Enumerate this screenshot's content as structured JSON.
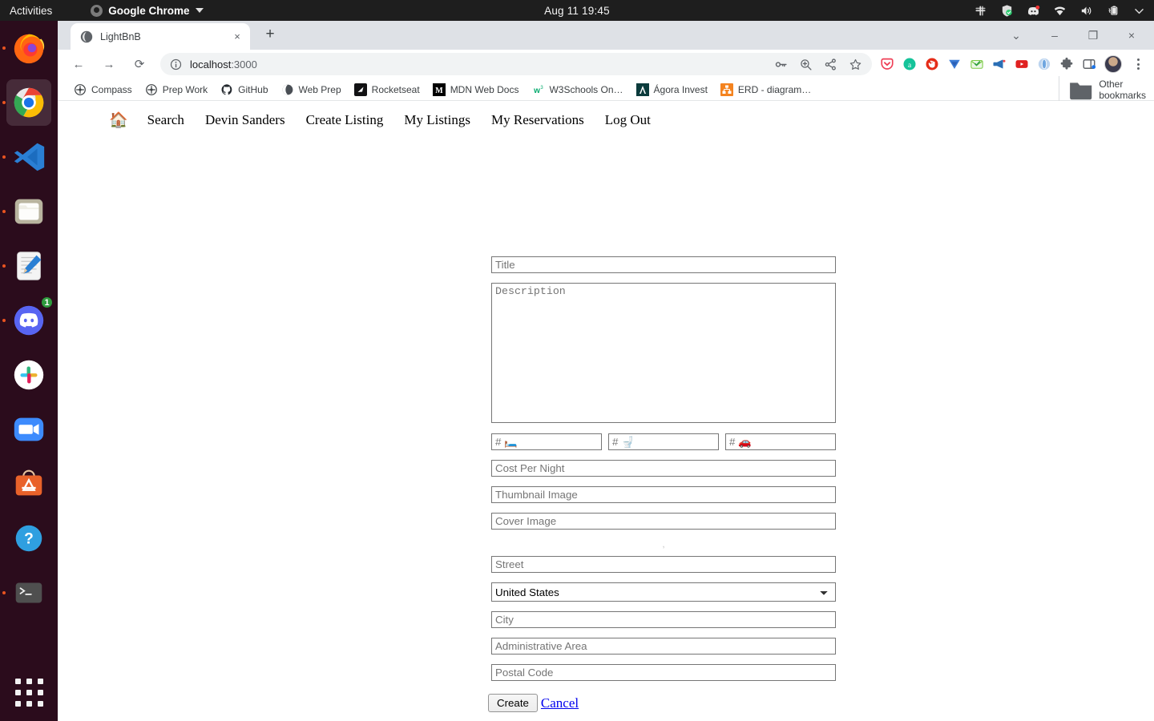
{
  "desktop": {
    "activities": "Activities",
    "app_menu": "Google Chrome",
    "clock": "Aug 11  19:45",
    "tray_icons": [
      "slack-icon",
      "shield-check-icon",
      "discord-icon",
      "wifi-icon",
      "volume-icon",
      "battery-charging-icon",
      "system-menu-caret-icon"
    ],
    "dock": [
      {
        "name": "firefox",
        "label": "Firefox",
        "running": true,
        "badge": ""
      },
      {
        "name": "google-chrome",
        "label": "Google Chrome",
        "running": true,
        "badge": "",
        "active": true
      },
      {
        "name": "visual-studio-code",
        "label": "Visual Studio Code",
        "running": true,
        "badge": ""
      },
      {
        "name": "files",
        "label": "Files",
        "running": true,
        "badge": ""
      },
      {
        "name": "text-editor",
        "label": "Text Editor",
        "running": true,
        "badge": ""
      },
      {
        "name": "discord",
        "label": "Discord",
        "running": true,
        "badge": "1"
      },
      {
        "name": "slack",
        "label": "Slack",
        "running": false,
        "badge": ""
      },
      {
        "name": "zoom",
        "label": "Zoom",
        "running": false,
        "badge": ""
      },
      {
        "name": "ubuntu-software",
        "label": "Ubuntu Software",
        "running": false,
        "badge": ""
      },
      {
        "name": "help",
        "label": "Help",
        "running": false,
        "badge": ""
      },
      {
        "name": "terminal",
        "label": "Terminal",
        "running": true,
        "badge": ""
      }
    ]
  },
  "browser": {
    "tab": {
      "title": "LightBnB",
      "favicon": "globe-icon",
      "close_label": "×"
    },
    "new_tab_label": "+",
    "window_controls": {
      "search_tabs": "⌄",
      "minimize": "–",
      "maximize": "❐",
      "close": "×"
    },
    "nav_buttons": {
      "back": "←",
      "forward": "→",
      "reload": "⟳"
    },
    "omnibox": {
      "url_host": "localhost",
      "url_port": ":3000",
      "site_info_icon": "info-circle-icon",
      "right_icons": [
        "password-key-icon",
        "zoom-in-icon",
        "share-icon",
        "bookmark-star-icon"
      ]
    },
    "extensions": [
      "pocket-icon",
      "grammarly-a-icon",
      "adblock-icon",
      "bluejeans-icon",
      "mailtrack-icon",
      "megaphone-icon",
      "youtube-icon",
      "opera-icon",
      "puzzle-extensions-icon",
      "side-panel-icon"
    ],
    "profile": "avatar",
    "menu": "chrome-menu-icon",
    "bookmarks": [
      {
        "label": "Compass",
        "icon": "compass-icon"
      },
      {
        "label": "Prep Work",
        "icon": "compass-icon"
      },
      {
        "label": "GitHub",
        "icon": "github-icon"
      },
      {
        "label": "Web Prep",
        "icon": "globe-icon"
      },
      {
        "label": "Rocketseat",
        "icon": "rocketseat-icon"
      },
      {
        "label": "MDN Web Docs",
        "icon": "mdn-icon"
      },
      {
        "label": "W3Schools On…",
        "icon": "w3schools-icon"
      },
      {
        "label": "Ágora Invest",
        "icon": "agora-icon"
      },
      {
        "label": "ERD - diagram…",
        "icon": "erd-icon"
      }
    ],
    "other_bookmarks": {
      "label": "Other bookmarks",
      "icon": "folder-icon"
    }
  },
  "page": {
    "nav": {
      "home_icon": "🏠",
      "links": [
        "Search",
        "Devin Sanders",
        "Create Listing",
        "My Listings",
        "My Reservations",
        "Log Out"
      ]
    },
    "form": {
      "title": {
        "placeholder": "Title",
        "value": ""
      },
      "description": {
        "placeholder": "Description",
        "value": ""
      },
      "bedrooms": {
        "placeholder": "# 🛏️",
        "value": ""
      },
      "bathrooms": {
        "placeholder": "# 🚽",
        "value": ""
      },
      "parking": {
        "placeholder": "# 🚗",
        "value": ""
      },
      "cost_per_night": {
        "placeholder": "Cost Per Night",
        "value": ""
      },
      "thumbnail_image": {
        "placeholder": "Thumbnail Image",
        "value": ""
      },
      "cover_image": {
        "placeholder": "Cover Image",
        "value": ""
      },
      "separator_text": ",",
      "street": {
        "placeholder": "Street",
        "value": ""
      },
      "country": {
        "selected": "United States",
        "options": [
          "United States"
        ]
      },
      "city": {
        "placeholder": "City",
        "value": ""
      },
      "administrative_area": {
        "placeholder": "Administrative Area",
        "value": ""
      },
      "postal_code": {
        "placeholder": "Postal Code",
        "value": ""
      },
      "submit_label": "Create",
      "cancel_label": "Cancel"
    }
  }
}
